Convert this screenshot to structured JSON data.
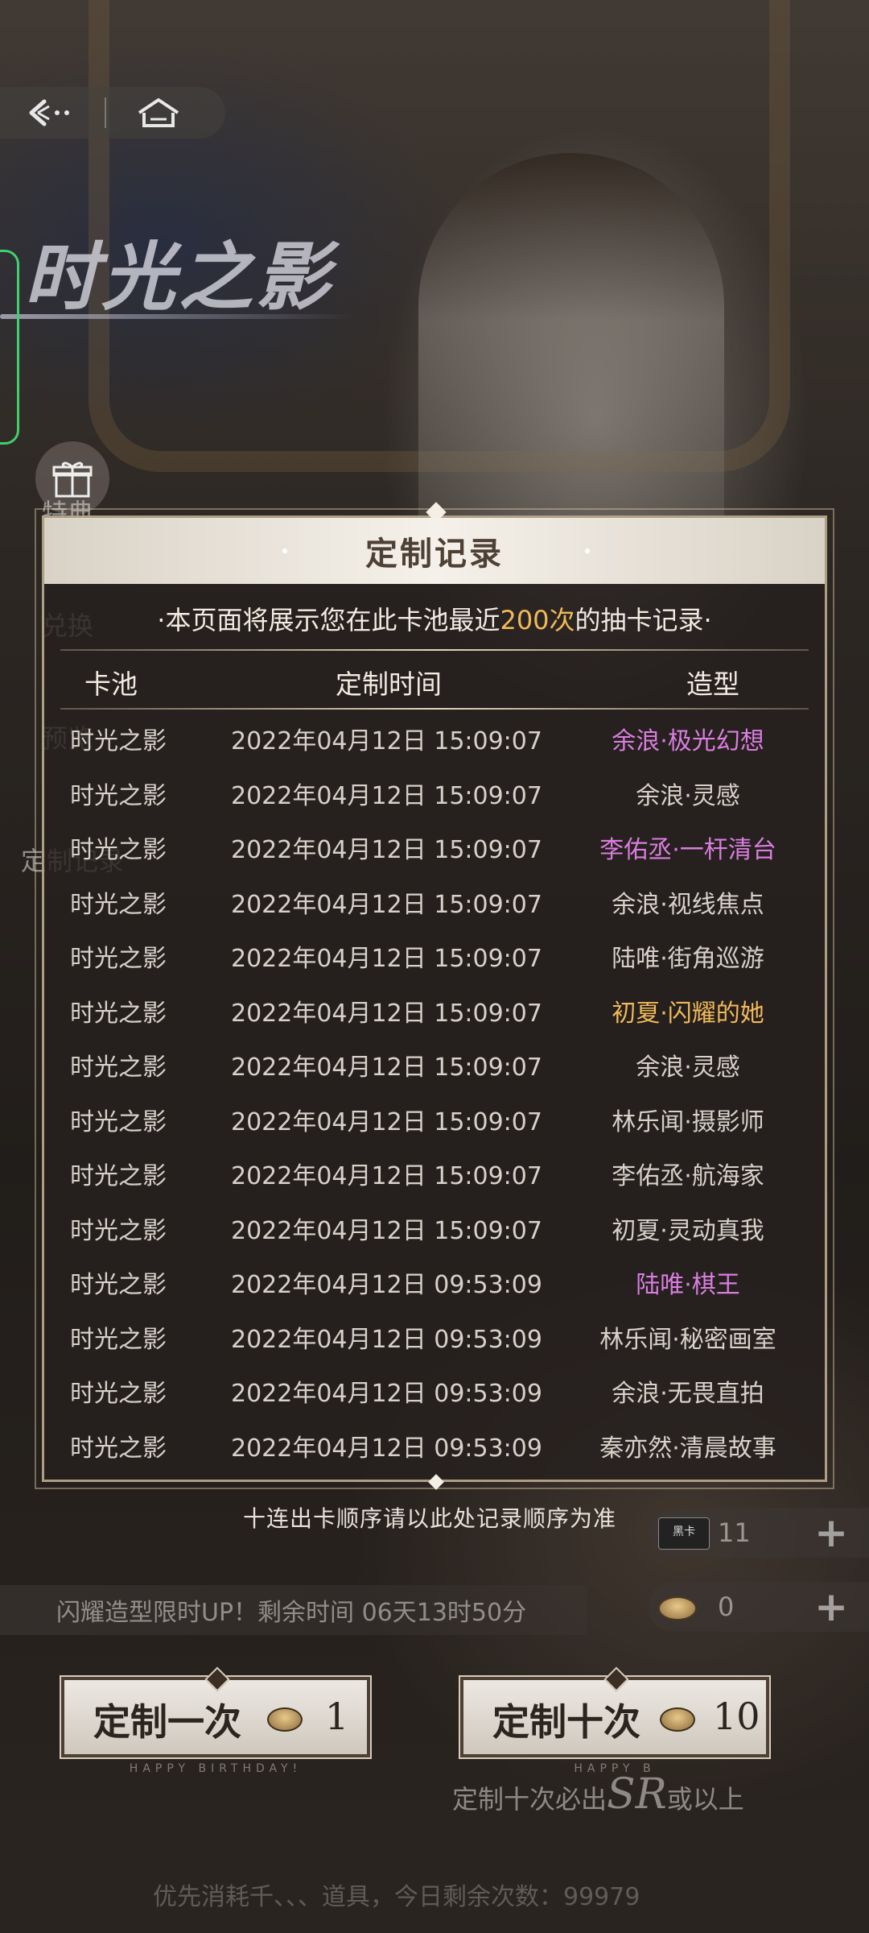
{
  "banner": {
    "title": "时光之影",
    "side_labels": [
      "特典",
      "兑换",
      "预览",
      "定制记录"
    ]
  },
  "records": {
    "title": "定制记录",
    "notice_prefix": "·本页面将展示您在此卡池最近",
    "notice_highlight": "200次",
    "notice_suffix": "的抽卡记录·",
    "columns": {
      "pool": "卡池",
      "time": "定制时间",
      "style": "造型"
    },
    "rows": [
      {
        "pool": "时光之影",
        "time": "2022年04月12日 15:09:07",
        "style": "余浪·极光幻想",
        "color": "#d97ee0"
      },
      {
        "pool": "时光之影",
        "time": "2022年04月12日 15:09:07",
        "style": "余浪·灵感",
        "color": "#d7d1ca"
      },
      {
        "pool": "时光之影",
        "time": "2022年04月12日 15:09:07",
        "style": "李佑丞·一杆清台",
        "color": "#d97ee0"
      },
      {
        "pool": "时光之影",
        "time": "2022年04月12日 15:09:07",
        "style": "余浪·视线焦点",
        "color": "#d7d1ca"
      },
      {
        "pool": "时光之影",
        "time": "2022年04月12日 15:09:07",
        "style": "陆唯·街角巡游",
        "color": "#d7d1ca"
      },
      {
        "pool": "时光之影",
        "time": "2022年04月12日 15:09:07",
        "style": "初夏·闪耀的她",
        "color": "#f0b95a"
      },
      {
        "pool": "时光之影",
        "time": "2022年04月12日 15:09:07",
        "style": "余浪·灵感",
        "color": "#d7d1ca"
      },
      {
        "pool": "时光之影",
        "time": "2022年04月12日 15:09:07",
        "style": "林乐闻·摄影师",
        "color": "#d7d1ca"
      },
      {
        "pool": "时光之影",
        "time": "2022年04月12日 15:09:07",
        "style": "李佑丞·航海家",
        "color": "#d7d1ca"
      },
      {
        "pool": "时光之影",
        "time": "2022年04月12日 15:09:07",
        "style": "初夏·灵动真我",
        "color": "#d7d1ca"
      },
      {
        "pool": "时光之影",
        "time": "2022年04月12日 09:53:09",
        "style": "陆唯·棋王",
        "color": "#d97ee0"
      },
      {
        "pool": "时光之影",
        "time": "2022年04月12日 09:53:09",
        "style": "林乐闻·秘密画室",
        "color": "#d7d1ca"
      },
      {
        "pool": "时光之影",
        "time": "2022年04月12日 09:53:09",
        "style": "余浪·无畏直拍",
        "color": "#d7d1ca"
      },
      {
        "pool": "时光之影",
        "time": "2022年04月12日 09:53:09",
        "style": "秦亦然·清晨故事",
        "color": "#d7d1ca"
      }
    ],
    "footer_note": "十连出卡顺序请以此处记录顺序为准"
  },
  "currency": [
    {
      "icon": "black-card-icon",
      "chip_text": "黑卡",
      "value": "11"
    },
    {
      "icon": "coin-icon",
      "value": "0"
    }
  ],
  "timer_text": "闪耀造型限时UP！剩余时间 06天13时50分",
  "buttons": {
    "single": {
      "label": "定制一次",
      "count": "1",
      "sub": "HAPPY BIRTHDAY!"
    },
    "ten": {
      "label": "定制十次",
      "count": "10",
      "sub": "HAPPY B"
    }
  },
  "guarantee": {
    "prefix": "定制十次必出",
    "rarity": "SR",
    "suffix": "或以上"
  },
  "bottom_info": "优先消耗千、、、道具，今日剩余次数：99979"
}
